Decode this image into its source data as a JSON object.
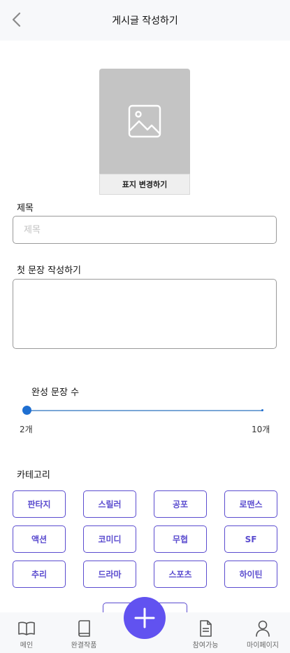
{
  "header": {
    "title": "게시글 작성하기"
  },
  "cover": {
    "change_label": "표지 변경하기"
  },
  "title_field": {
    "label": "제목",
    "placeholder": "제목",
    "value": ""
  },
  "first_sentence": {
    "label": "첫 문장 작성하기",
    "value": ""
  },
  "sentence_count": {
    "label": "완성 문장 수",
    "min_label": "2개",
    "max_label": "10개",
    "min": 2,
    "max": 10,
    "value": 2
  },
  "category": {
    "label": "카테고리",
    "items": [
      "판타지",
      "스릴러",
      "공포",
      "로맨스",
      "액션",
      "코미디",
      "무협",
      "SF",
      "추리",
      "드라마",
      "스포츠",
      "하이틴"
    ]
  },
  "submit": {
    "label": ""
  },
  "tabbar": {
    "items": [
      {
        "label": "메인",
        "icon": "book-open-icon"
      },
      {
        "label": "완결작품",
        "icon": "book-icon"
      },
      {
        "label": "참여가능",
        "icon": "document-icon"
      },
      {
        "label": "마이페이지",
        "icon": "person-icon"
      }
    ],
    "fab_icon": "plus-icon"
  },
  "colors": {
    "accent": "#5b4ccf",
    "fab": "#6152f0",
    "slider": "#1f6fd1",
    "cover": "#c4c4c4"
  }
}
